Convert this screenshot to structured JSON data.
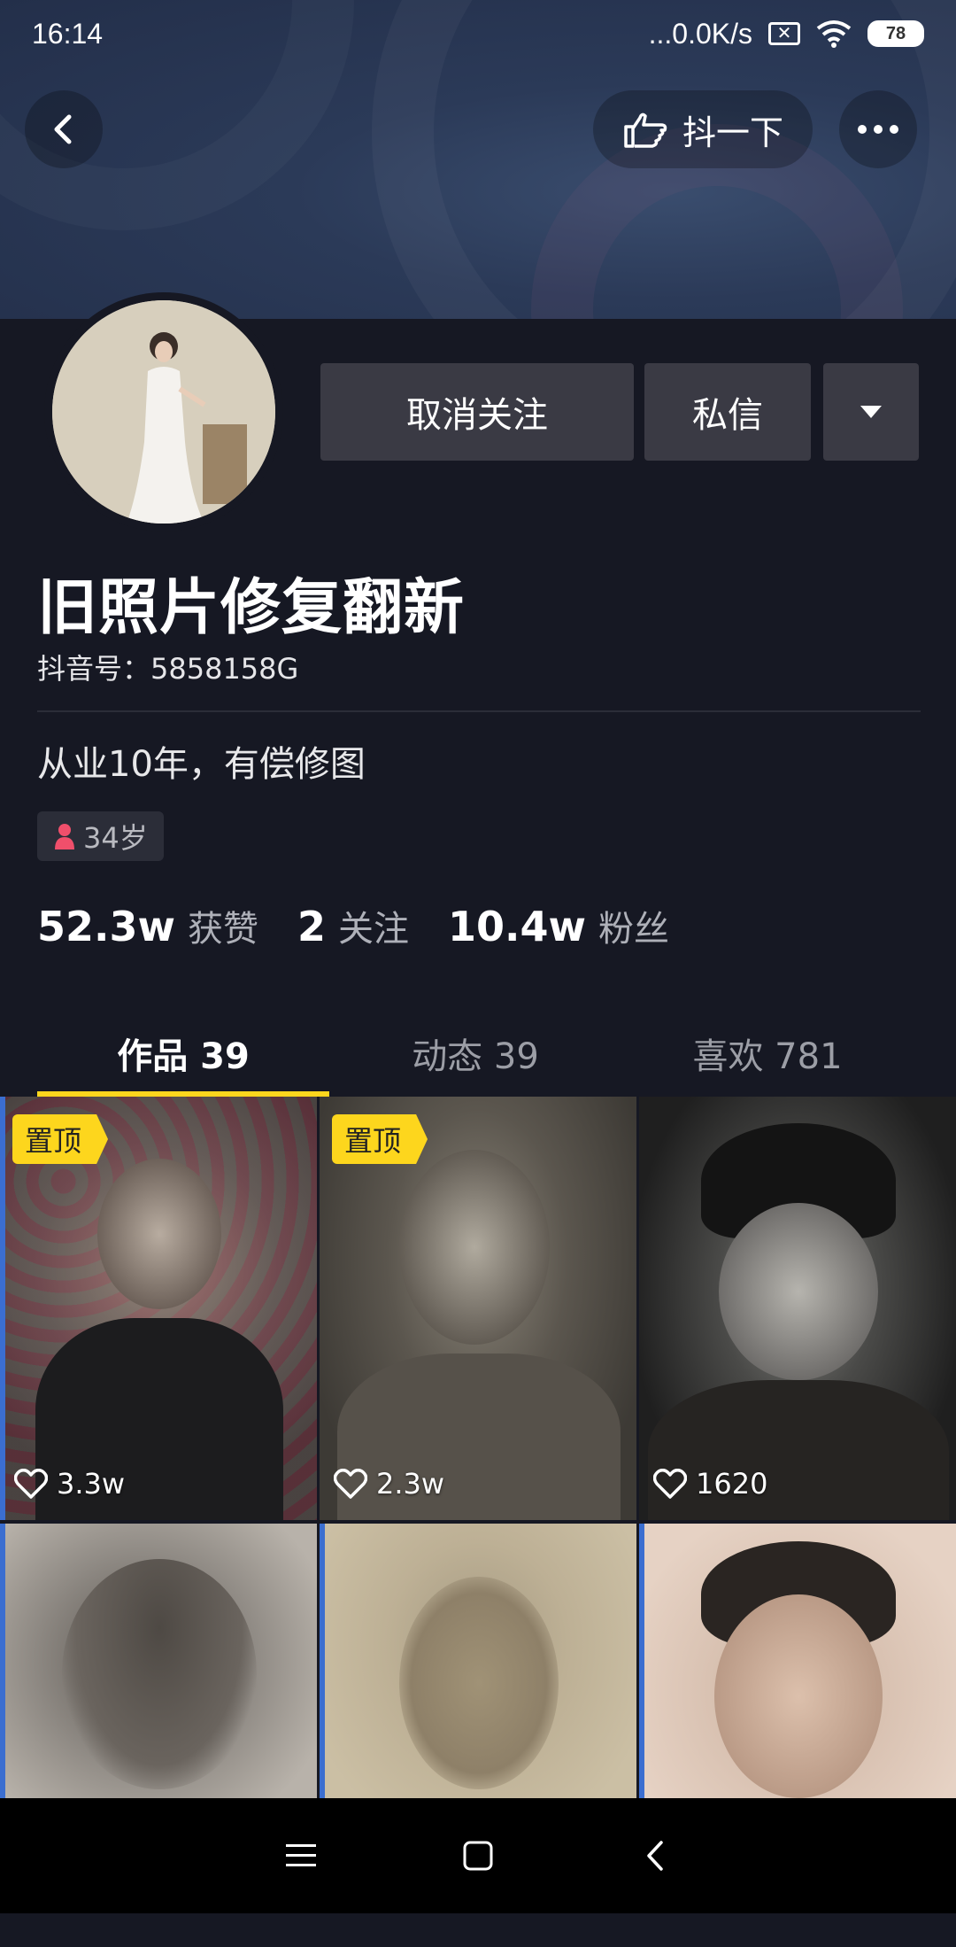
{
  "status_bar": {
    "time": "16:14",
    "network_speed": "...0.0K/s",
    "battery": "78"
  },
  "header": {
    "back_icon": "chevron-left-icon",
    "shake_label": "抖一下",
    "shake_icon": "hand-point-icon",
    "more_icon": "ellipsis-icon"
  },
  "profile": {
    "name": "旧照片修复翻新",
    "douyin_id": "抖音号：5858158G",
    "bio": "从业10年，有偿修图",
    "age": "34岁",
    "age_icon": "female-person-icon"
  },
  "actions": {
    "unfollow_label": "取消关注",
    "message_label": "私信",
    "dropdown_icon": "triangle-down-icon"
  },
  "stats": [
    {
      "value": "52.3w",
      "label": "获赞"
    },
    {
      "value": "2",
      "label": "关注"
    },
    {
      "value": "10.4w",
      "label": "粉丝"
    }
  ],
  "tabs": [
    {
      "label": "作品 39",
      "active": true
    },
    {
      "label": "动态 39",
      "active": false
    },
    {
      "label": "喜欢 781",
      "active": false
    }
  ],
  "videos": [
    {
      "pinned": "置顶",
      "likes": "3.3w"
    },
    {
      "pinned": "置顶",
      "likes": "2.3w"
    },
    {
      "pinned": "",
      "likes": "1620"
    },
    {
      "pinned": "",
      "likes": ""
    },
    {
      "pinned": "",
      "likes": ""
    },
    {
      "pinned": "",
      "likes": ""
    }
  ],
  "colors": {
    "background": "#161823",
    "accent_yellow": "#fdd61d",
    "button_gray": "#3a3a44"
  },
  "nav": {
    "menu_icon": "menu-icon",
    "home_icon": "square-home-icon",
    "back_icon": "chevron-left-icon"
  }
}
